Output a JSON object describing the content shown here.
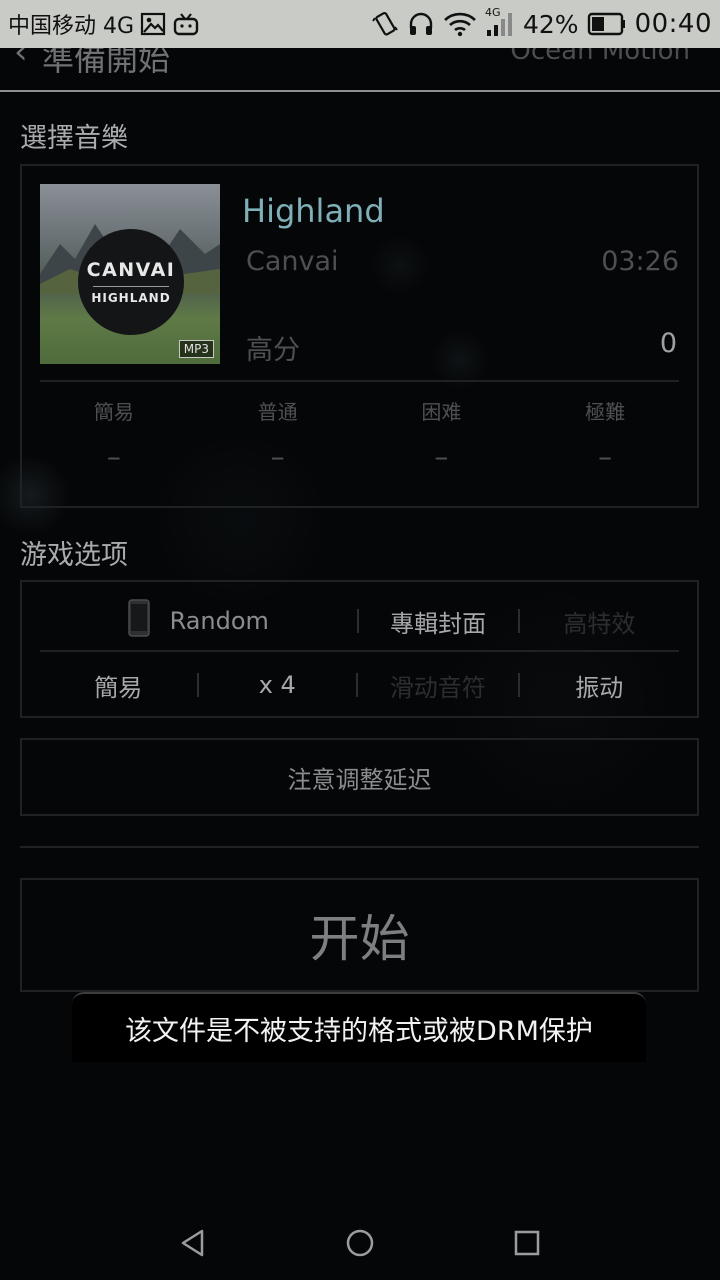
{
  "status_bar": {
    "carrier": "中国移动 4G",
    "network_badge": "4G",
    "battery_percent": "42%",
    "time": "00:40",
    "icons": [
      "image-icon",
      "tv-icon",
      "vibrate-icon",
      "headphones-icon",
      "wifi-icon",
      "signal-icon",
      "battery-icon"
    ]
  },
  "header": {
    "back_icon": "chevron-left-icon",
    "title": "準備開始",
    "right_text": "Ocean Motion"
  },
  "music_section": {
    "title": "選擇音樂",
    "album": {
      "artist_text": "CANVAI",
      "album_text": "HIGHLAND",
      "format_badge": "MP3"
    },
    "song_title": "Highland",
    "artist": "Canvai",
    "duration": "03:26",
    "high_score_label": "高分",
    "high_score_value": "0",
    "difficulties": [
      {
        "name": "簡易",
        "score": "–"
      },
      {
        "name": "普通",
        "score": "–"
      },
      {
        "name": "困难",
        "score": "–"
      },
      {
        "name": "極難",
        "score": "–"
      }
    ]
  },
  "options_section": {
    "title": "游戏选项",
    "row1": {
      "device_icon": "phone-icon",
      "mode": "Random",
      "album_cover": "專輯封面",
      "high_effects": "高特效"
    },
    "row2": {
      "difficulty": "簡易",
      "speed": "x 4",
      "slide_notes": "滑动音符",
      "vibration": "振动"
    }
  },
  "delay_button": "注意调整延迟",
  "start_button": "开始",
  "toast": "该文件是不被支持的格式或被DRM保护",
  "nav_bar": {
    "icons": [
      "back-triangle-icon",
      "home-circle-icon",
      "recents-square-icon"
    ]
  }
}
